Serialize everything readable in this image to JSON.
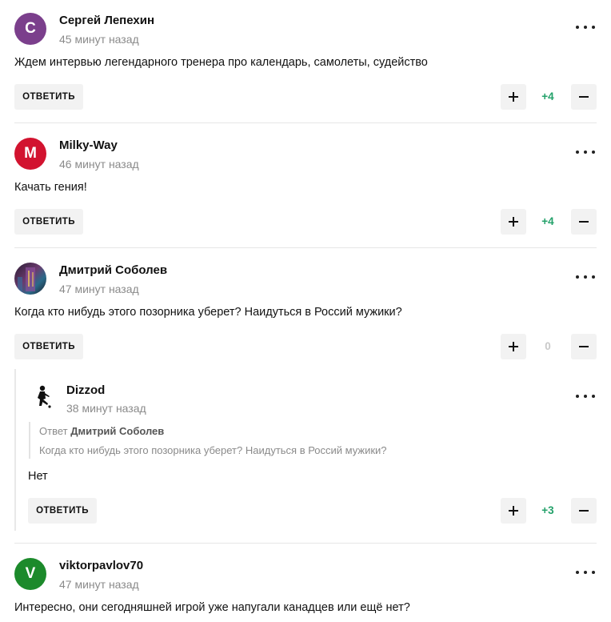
{
  "labels": {
    "reply": "ОТВЕТИТЬ",
    "quote_prefix": "Ответ"
  },
  "colors": {
    "positive": "#23a16a",
    "neutral": "#c9c9c9",
    "button_bg": "#f2f2f2"
  },
  "comments": [
    {
      "author": "Сергей Лепехин",
      "avatar_letter": "С",
      "avatar_color": "#7b3f8c",
      "time": "45 минут назад",
      "text": "Ждем интервью легендарного тренера про календарь, самолеты, судейство",
      "score": "+4"
    },
    {
      "author": "Milky-Way",
      "avatar_letter": "M",
      "avatar_color": "#d2132f",
      "time": "46 минут назад",
      "text": "Качать гения!",
      "score": "+4"
    },
    {
      "author": "Дмитрий Соболев",
      "avatar_letter": "",
      "avatar_color": "#3a2a3f",
      "time": "47 минут назад",
      "text": "Когда кто нибудь этого позорника уберет? Наидуться в Россий мужики?",
      "score": "0"
    },
    {
      "author": "Dizzod",
      "avatar_letter": "",
      "avatar_color": "#ffffff",
      "time": "38 минут назад",
      "quote_author": "Дмитрий Соболев",
      "quote_text": "Когда кто нибудь этого позорника уберет? Наидуться в Россий мужики?",
      "text": "Нет",
      "score": "+3"
    },
    {
      "author": "viktorpavlov70",
      "avatar_letter": "V",
      "avatar_color": "#1c8a2b",
      "time": "47 минут назад",
      "text": "Интересно, они сегодняшней игрой уже напугали канадцев или ещё нет?",
      "score": ""
    }
  ]
}
